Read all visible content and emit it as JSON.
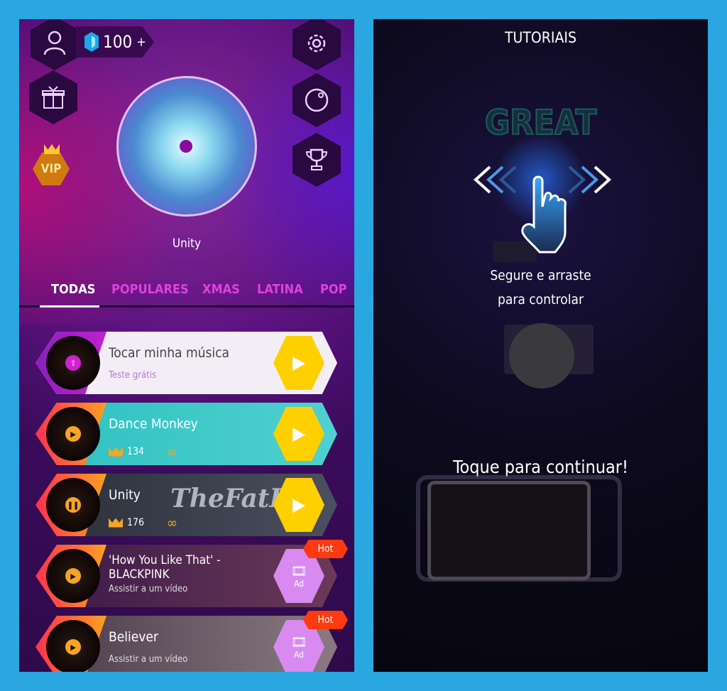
{
  "left": {
    "gems": "100",
    "gems_plus": "+",
    "vip_label": "VIP",
    "now_playing": "Unity",
    "tabs": [
      {
        "label": "TODAS",
        "active": true
      },
      {
        "label": "POPULARES"
      },
      {
        "label": "XMAS"
      },
      {
        "label": "LATINA"
      },
      {
        "label": "POP"
      }
    ],
    "songs": [
      {
        "title": "Tocar minha música",
        "subtitle": "Teste grátis",
        "button": "play",
        "icon": "upload"
      },
      {
        "title": "Dance Monkey",
        "crowns": "134",
        "button": "play",
        "icon": "play"
      },
      {
        "title": "Unity",
        "crowns": "176",
        "button": "play",
        "icon": "pause",
        "art_text": "TheFatRat"
      },
      {
        "title": "'How You Like That' -\nBLACKPINK",
        "subtitle": "Assistir a um vídeo",
        "button": "ad",
        "badge": "Hot",
        "icon": "play"
      },
      {
        "title": "Believer",
        "subtitle": "Assistir a um vídeo",
        "button": "ad",
        "badge": "Hot",
        "icon": "play"
      }
    ],
    "ad_label": "Ad"
  },
  "right": {
    "title": "TUTORIAIS",
    "great": "GREAT",
    "instruction_line1": "Segure e arraste",
    "instruction_line2": "para controlar",
    "continue": "Toque para continuar!"
  },
  "colors": {
    "accent": "#e040e0",
    "play": "#ffd000",
    "hot": "#ff3a10",
    "frame": "#2aa6e0"
  }
}
